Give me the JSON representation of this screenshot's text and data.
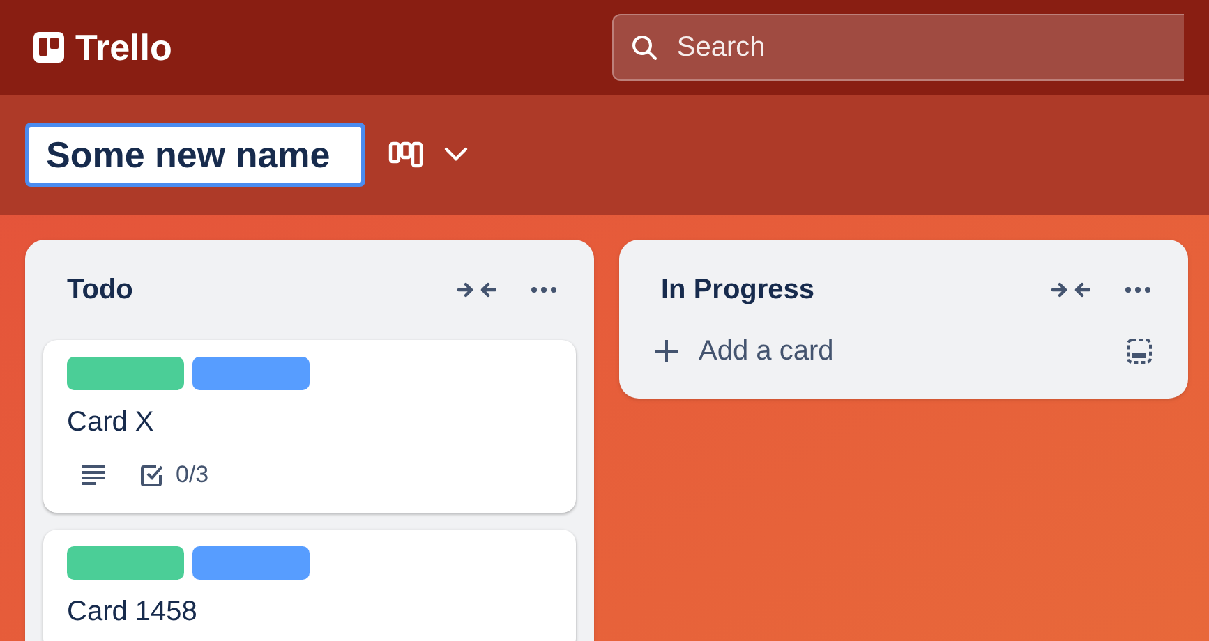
{
  "app": {
    "logo_text": "Trello"
  },
  "search": {
    "placeholder": "Search"
  },
  "board": {
    "name": "Some new name"
  },
  "lists": [
    {
      "title": "Todo",
      "cards": [
        {
          "title": "Card X",
          "labels": [
            {
              "color": "#4bce97"
            },
            {
              "color": "#579dff"
            }
          ],
          "badges": [
            {
              "kind": "description"
            },
            {
              "kind": "checklist",
              "text": "0/3"
            }
          ]
        },
        {
          "title": "Card 1458",
          "labels": [
            {
              "color": "#4bce97"
            },
            {
              "color": "#579dff"
            }
          ]
        }
      ]
    },
    {
      "title": "In Progress",
      "add_card": "Add a card"
    }
  ]
}
